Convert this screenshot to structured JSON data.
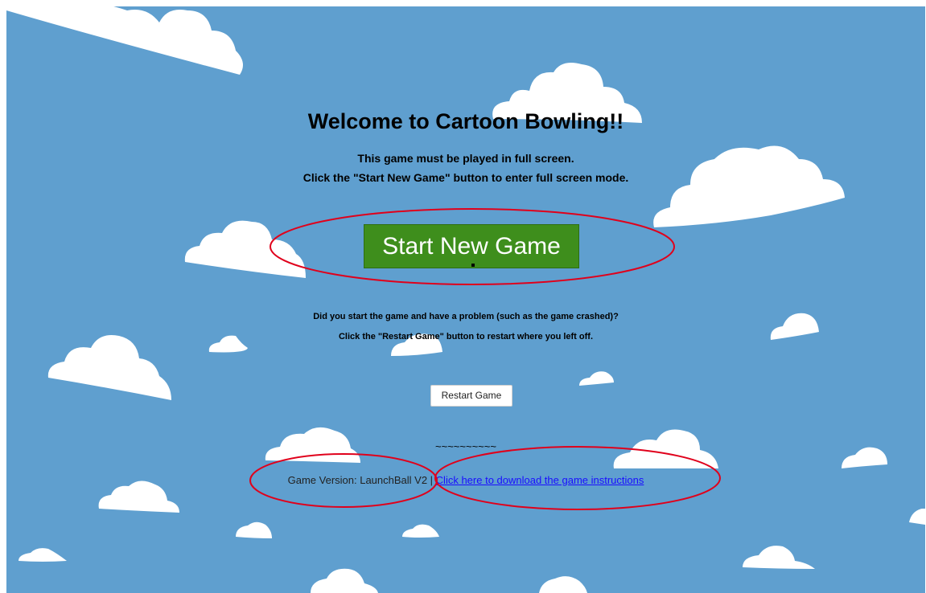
{
  "page": {
    "title": "Welcome to Cartoon Bowling!!",
    "intro_line1": "This game must be played in full screen.",
    "intro_line2": "Click the \"Start New Game\" button to enter full screen mode."
  },
  "start_button": {
    "label": "Start New Game"
  },
  "problem": {
    "line1": "Did you start the game and have a problem (such as the game crashed)?",
    "line2": "Click the \"Restart Game\" button to restart where you left off."
  },
  "restart_button": {
    "label": "Restart Game"
  },
  "divider": "~~~~~~~~~~",
  "footer": {
    "version_text": "Game Version: LaunchBall V2",
    "separator": " | ",
    "download_link": "Click here to download the game instructions"
  },
  "colors": {
    "sky": "#5f9fcf",
    "cloud": "#ffffff",
    "start_button": "#3e8e1c",
    "annotation": "#e0001b",
    "link": "#1a0dff"
  },
  "icons": [
    "cloud-icon",
    "cursor-icon"
  ]
}
